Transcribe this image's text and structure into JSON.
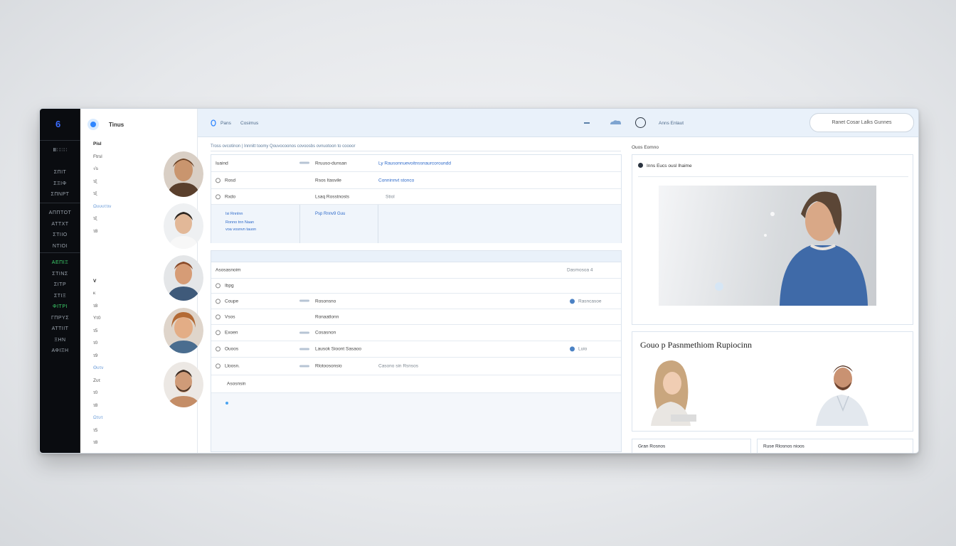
{
  "rail": {
    "logo": "6",
    "group1": [
      "Ⅲ∷∷∷",
      "",
      "ΣΠΙΤ",
      "ΣΞΙΦ",
      "ΣΠΝΡΤ"
    ],
    "group2": [
      "ΑΠΠΤΟΤ",
      "ΑΤΤΧΤ",
      "ΣΤΙΙΟ",
      "ΝΤΙΟΙ"
    ],
    "group3": [
      "ΑΕΠΙΞ",
      "ΣΤΙΝΣ",
      "ΣΙΤΡ",
      "ΣΤΙΞ",
      "ΦΙΤΡΙ",
      "ΓΠΡΥΣ",
      "ΑΤΤΙΙΤ",
      "ΞΗΝ",
      "ΑΦΙΞΗ"
    ]
  },
  "contacts": {
    "title": "Tinus",
    "items": [
      "Pisl",
      "Ftrsl",
      "√s",
      "τξ",
      "τξ",
      "Ωυυυττιν",
      "τξ",
      "τ8",
      "",
      "",
      "",
      "V",
      "κ",
      "τ8",
      "Υτ0",
      "τ5",
      "τ0",
      "τ9",
      "Θυτν",
      "Ζυτ",
      "τ0",
      "τ8",
      "Ωτυτ",
      "τ5",
      "τ8"
    ],
    "bold_items": [
      0,
      11
    ]
  },
  "topbar": {
    "left_a": "Pans",
    "left_b": "Cosimus",
    "right_text": "Anns Enlaut",
    "search_text": "Ranet  Cosar Lalks Gunnes"
  },
  "breadcrumb": "Tross ovcotinon | Innnitt toomy  Qouvocoonos covoosbs  ovnuotoon to coooor",
  "table1": {
    "rows": [
      {
        "a": "Iuaind",
        "b": "Rruuso-dunsan",
        "c": "Ly  Rausonnuevoitnssnaurcoroundd"
      },
      {
        "a": "Rosd",
        "b": "Rsos Itasvile",
        "c": "Conninnvt stonco"
      },
      {
        "a": "Rxdo",
        "b": "Lsaq Rosstnosts",
        "c": "Stiol"
      }
    ],
    "sub": {
      "a1": "Isi Rnnlnn",
      "a2": "Ronno tnn Naan",
      "a3": "voa vosnvn tauon",
      "b": "Psp Rnnv9 Guu"
    }
  },
  "table2": {
    "header": "Asosasnoim",
    "header_right": "Dasmosoa  4",
    "rows": [
      {
        "a": "Ibpg",
        "b": "",
        "c": ""
      },
      {
        "a": "Coupe",
        "b": "Rosonsno",
        "c": "Rasncasoe"
      },
      {
        "a": "Vsos",
        "b": "Ronaatlonn",
        "c": ""
      },
      {
        "a": "Exoen",
        "b": "Cosasnon",
        "c": ""
      },
      {
        "a": "Ouoos",
        "b": "Lausok Sioont Sasaoo",
        "c": "Luio"
      },
      {
        "a": "Lloosn.",
        "b": "Rlotoosonsio",
        "c": "Casono sin Rsnsos"
      },
      {
        "a": "Asosnsin",
        "b": "",
        "c": ""
      }
    ]
  },
  "right": {
    "label": "Ouos  Eomno",
    "card1_title": "Inns Eucs ousl Ihaime",
    "card2_title": "Gouo p Pasnmethiom Rupiocinn",
    "bottom_left": "Gran Rosnos",
    "bottom_right": "Ruse  Rlosnos nioos"
  },
  "colors": {
    "accent": "#2f86ff",
    "rail": "#0a0c10",
    "toolbar": "#e9f1fa",
    "green": "#3dd06b"
  }
}
